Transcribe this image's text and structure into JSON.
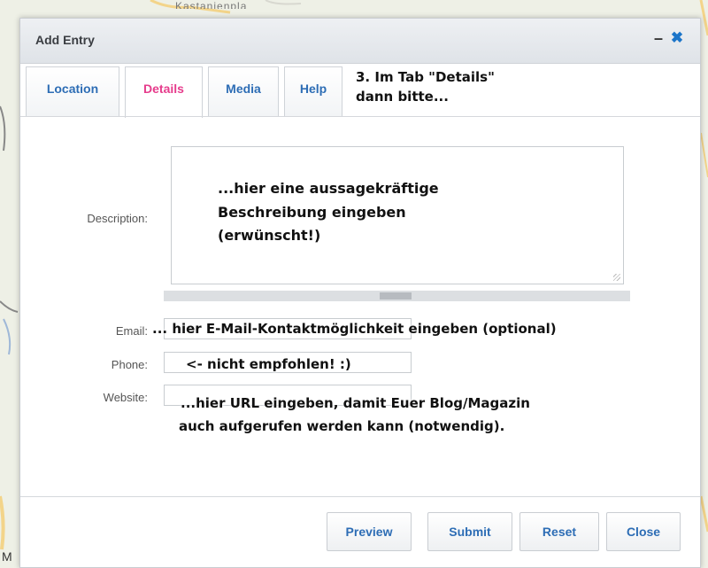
{
  "map": {
    "label_top": "Kastanienpla",
    "letter_m": "M"
  },
  "dialog": {
    "title": "Add Entry",
    "minimize_label": "–",
    "close_label": "✖",
    "tabs": [
      {
        "label": "Location",
        "active": false
      },
      {
        "label": "Details",
        "active": true
      },
      {
        "label": "Media",
        "active": false
      },
      {
        "label": "Help",
        "active": false
      }
    ],
    "fields": {
      "description_label": "Description:",
      "email_label": "Email:",
      "phone_label": "Phone:",
      "website_label": "Website:"
    },
    "buttons": {
      "preview": "Preview",
      "submit": "Submit",
      "reset": "Reset",
      "close": "Close"
    }
  },
  "annotations": {
    "tab_note_line1": "3. Im Tab \"Details\"",
    "tab_note_line2": "dann bitte...",
    "desc_line1": "...hier eine aussagekräftige",
    "desc_line2": "Beschreibung eingeben",
    "desc_line3": "(erwünscht!)",
    "email_note": "... hier E-Mail-Kontaktmöglichkeit eingeben (optional)",
    "phone_note": "<- nicht empfohlen! :)",
    "website_line1": "...hier URL eingeben, damit Euer Blog/Magazin",
    "website_line2": "auch aufgerufen werden kann (notwendig)."
  },
  "colors": {
    "accent_blue": "#2d6db5",
    "active_tab_pink": "#e63c8c",
    "close_icon_blue": "#1c75c9"
  }
}
